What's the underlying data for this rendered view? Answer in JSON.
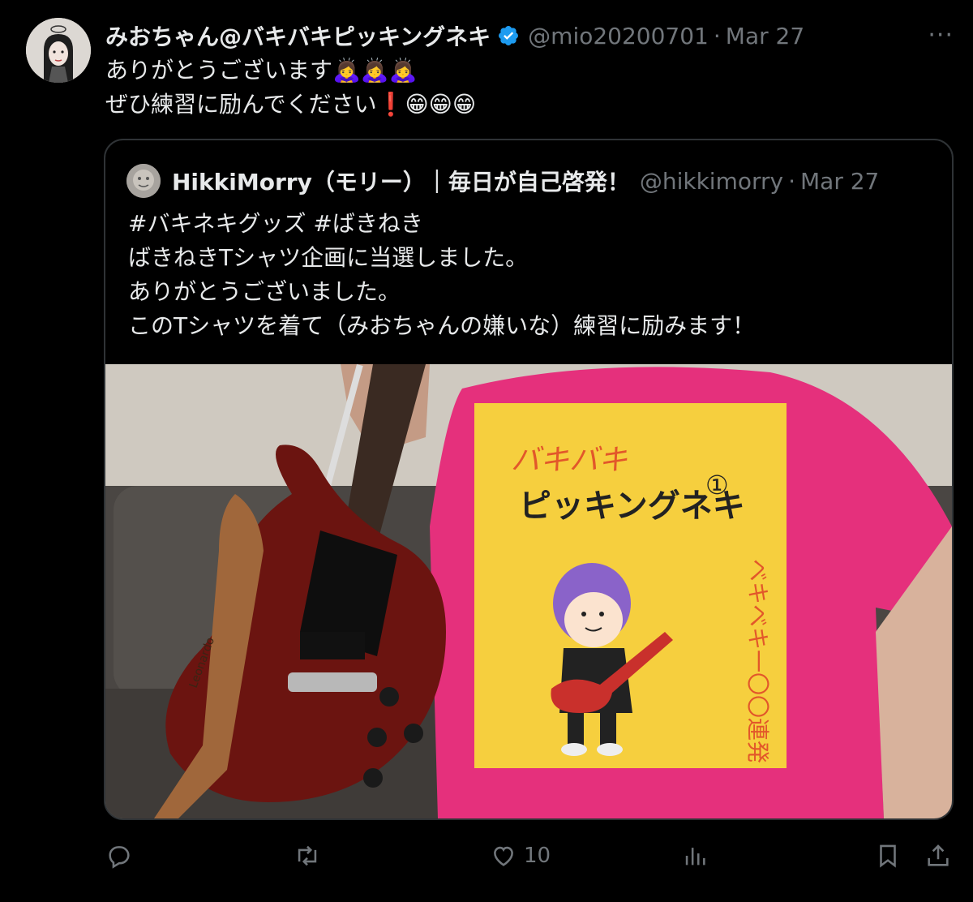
{
  "tweet": {
    "author_name": "みおちゃん@バキバキピッキングネキ",
    "handle": "@mio20200701",
    "separator": "·",
    "time": "Mar 27",
    "more_label": "···",
    "line1": "ありがとうございます🙇‍♀️🙇‍♀️🙇‍♀️",
    "line2": "ぜひ練習に励んでください❗😁😁😁"
  },
  "quote": {
    "author_name": "HikkiMorry（モリー）｜毎日が自己啓発！",
    "handle": "@hikkimorry",
    "separator": "·",
    "time": "Mar 27",
    "lines": [
      "#バキネキグッズ #ばきねき",
      "ばきねきTシャツ企画に当選しました。",
      "ありがとうございました。",
      "このTシャツを着て（みおちゃんの嫌いな）練習に励みます！"
    ],
    "shirt_title_1": "バキバキ",
    "shirt_title_2": "ピッキングネキ",
    "shirt_number": "①",
    "shirt_vertical": "ベキベキ一〇〇連発",
    "strap_brand": "Leonardo"
  },
  "actions": {
    "like_count": "10"
  },
  "colors": {
    "background": "#000000",
    "text": "#e7e9ea",
    "muted": "#71767b",
    "border": "#2f3336",
    "verified": "#1d9bf0",
    "shirt": "#e5307c",
    "print": "#f6cf3e"
  }
}
